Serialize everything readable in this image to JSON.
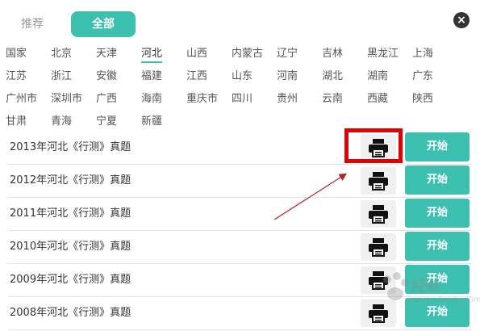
{
  "tabs": [
    {
      "label": "推荐",
      "active": false
    },
    {
      "label": "全部",
      "active": true
    }
  ],
  "close_icon": "×",
  "regions": [
    "国家",
    "北京",
    "天津",
    "河北",
    "山西",
    "内蒙古",
    "辽宁",
    "吉林",
    "黑龙江",
    "上海",
    "江苏",
    "浙江",
    "安徽",
    "福建",
    "江西",
    "山东",
    "河南",
    "湖北",
    "湖南",
    "广东",
    "广州市",
    "深圳市",
    "广西",
    "海南",
    "重庆市",
    "四川",
    "贵州",
    "云南",
    "西藏",
    "陕西",
    "甘肃",
    "青海",
    "宁夏",
    "新疆"
  ],
  "active_region": "河北",
  "exams": [
    {
      "title": "2013年河北《行测》真题",
      "start_label": "开始"
    },
    {
      "title": "2012年河北《行测》真题",
      "start_label": "开始"
    },
    {
      "title": "2011年河北《行测》真题",
      "start_label": "开始"
    },
    {
      "title": "2010年河北《行测》真题",
      "start_label": "开始"
    },
    {
      "title": "2009年河北《行测》真题",
      "start_label": "开始"
    },
    {
      "title": "2008年河北《行测》真题",
      "start_label": "开始"
    }
  ],
  "print_icon": "printer-icon",
  "colors": {
    "accent": "#3ec0b0",
    "highlight": "#e00000",
    "arrow": "#b22222"
  },
  "watermark": {
    "text": "经验",
    "url": "jingyan.baidu.com"
  }
}
